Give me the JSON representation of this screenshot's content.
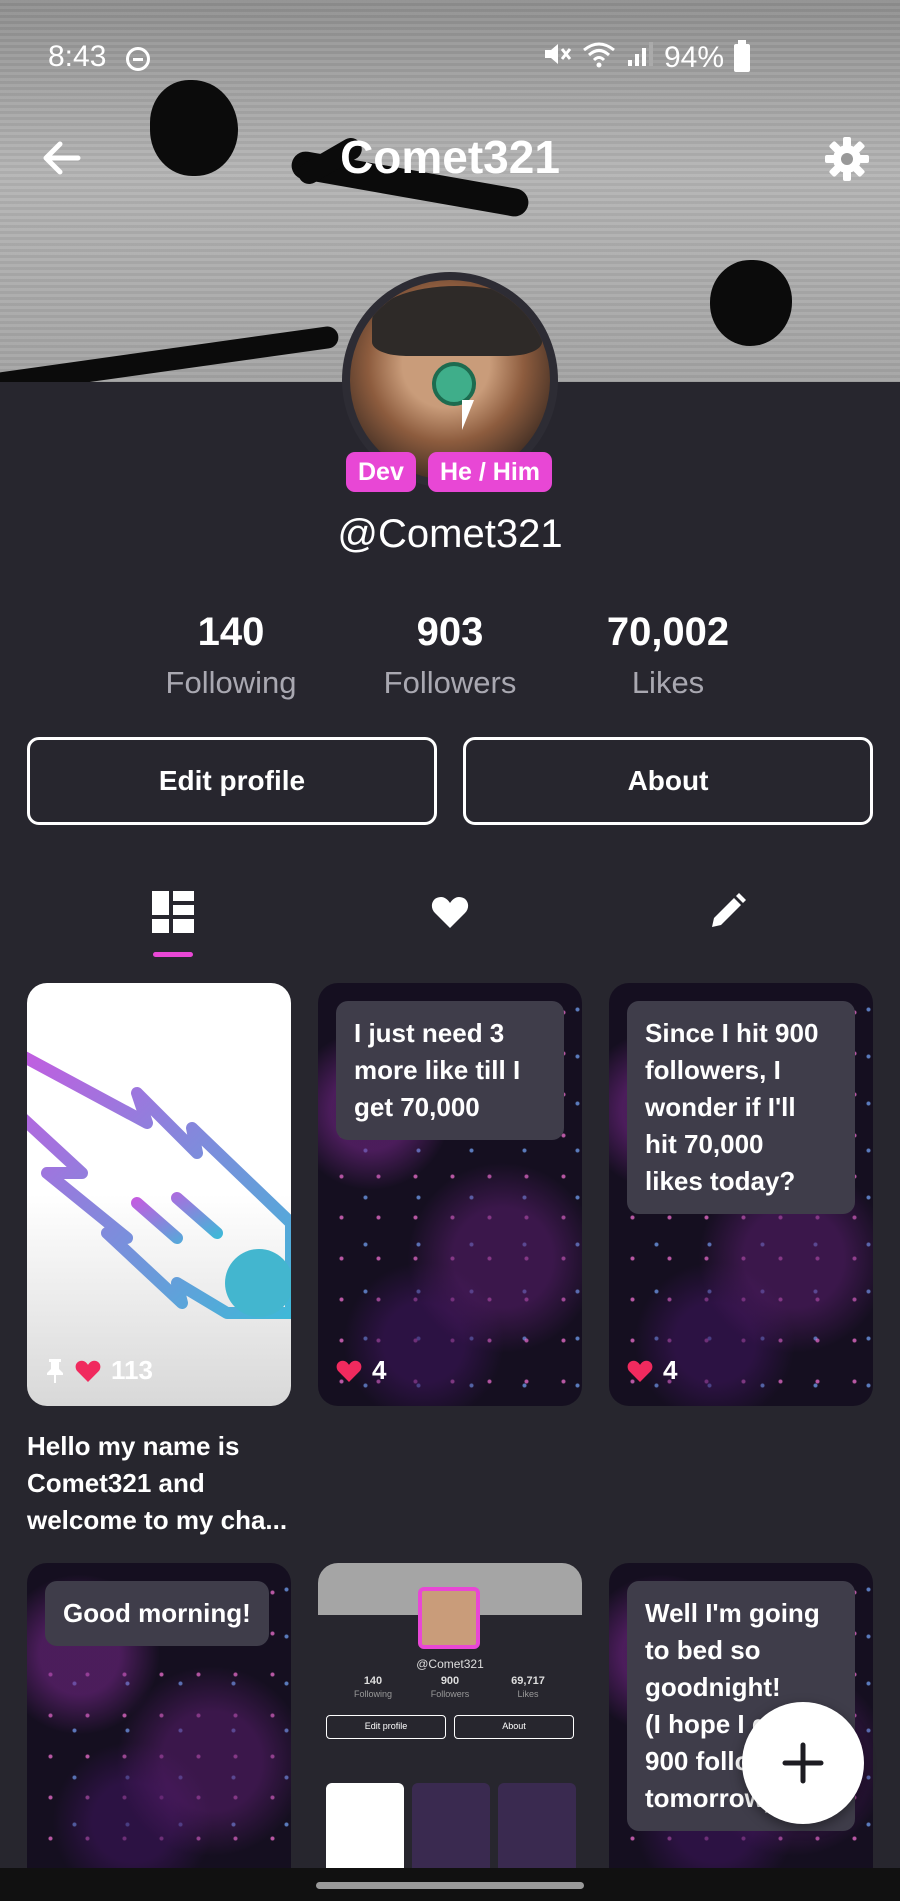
{
  "status_bar": {
    "time": "8:43",
    "battery": "94%",
    "icons": [
      "do-not-disturb-icon",
      "mute-icon",
      "wifi-icon",
      "signal-icon",
      "battery-icon"
    ]
  },
  "header": {
    "title": "Comet321",
    "back_icon": "back-arrow-icon",
    "settings_icon": "gear-icon"
  },
  "profile": {
    "badges": [
      "Dev",
      "He / Him"
    ],
    "handle": "@Comet321"
  },
  "stats": [
    {
      "value": "140",
      "label": "Following"
    },
    {
      "value": "903",
      "label": "Followers"
    },
    {
      "value": "70,002",
      "label": "Likes"
    }
  ],
  "actions": {
    "edit_profile": "Edit profile",
    "about": "About"
  },
  "tabs": [
    {
      "icon": "grid-icon",
      "active": true
    },
    {
      "icon": "heart-icon",
      "active": false
    },
    {
      "icon": "pencil-icon",
      "active": false
    }
  ],
  "posts": [
    {
      "likes": "113",
      "pinned": true,
      "caption": "Hello my name is Comet321 and welcome to my cha..."
    },
    {
      "text": "I just need 3\nmore like till I\nget 70,000",
      "likes": "4"
    },
    {
      "text": "Since I hit 900\nfollowers, I\nwonder if I'll\nhit 70,000\nlikes today?",
      "likes": "4"
    },
    {
      "text": "Good morning!"
    },
    {
      "mini": {
        "handle": "@Comet321",
        "stats": [
          {
            "value": "140",
            "label": "Following"
          },
          {
            "value": "900",
            "label": "Followers"
          },
          {
            "value": "69,717",
            "label": "Likes"
          }
        ],
        "edit": "Edit profile",
        "about": "About"
      }
    },
    {
      "text": "Well I'm going\nto bed so\ngoodnight!\n(I hope I get\n900 followers\ntomorrow)"
    }
  ],
  "colors": {
    "accent": "#e847d5",
    "heart": "#f02a5e",
    "background": "#27262e"
  }
}
